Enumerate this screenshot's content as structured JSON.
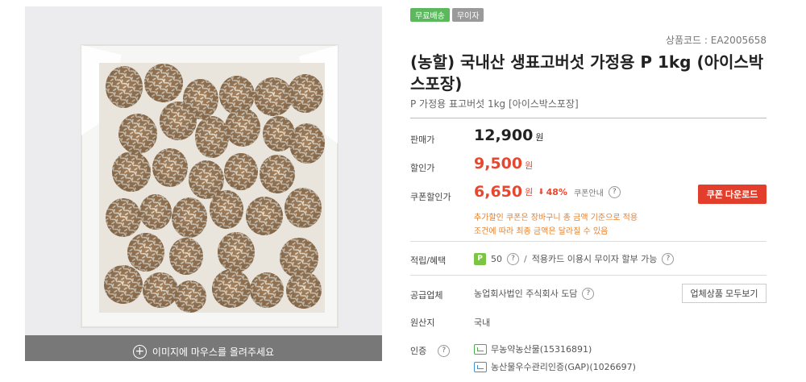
{
  "image": {
    "hover_hint": "이미지에 마우스를 올려주세요",
    "hover_icon": "plus-circle-icon",
    "colors": {
      "background": "#ececee",
      "box": "#f6f6f4",
      "mushroom": "#a98766",
      "overlay": "#6e6e6e"
    }
  },
  "badges": [
    {
      "label": "무료배송",
      "color": "#5cb85c"
    },
    {
      "label": "무이자",
      "color": "#9a9a9a"
    }
  ],
  "product": {
    "code": "상품코드 : EA2005658",
    "title": "(농할) 국내산 생표고버섯 가정용 P 1kg (아이스박스포장)",
    "subtitle": "P 가정용 표고버섯 1kg [아이스박스포장]"
  },
  "pricing": {
    "sale_label": "판매가",
    "sale_price": "12,900",
    "sale_unit": "원",
    "discount_label": "할인가",
    "discount_price": "9,500",
    "discount_unit": "원",
    "coupon_label": "쿠폰할인가",
    "coupon_price": "6,650",
    "coupon_unit": "원",
    "coupon_rate": "48%",
    "coupon_info": "쿠폰안내",
    "coupon_button": "쿠폰 다운로드",
    "note_line1": "추가할인 쿠폰은 장바구니 총 금액 기준으로 적용",
    "note_line2": "조건에 따라 최종 금액은 달라질 수 있음",
    "accent": "#e8472f",
    "note_color": "#e8802a"
  },
  "benefits": {
    "label": "적립/혜택",
    "points_icon": "P",
    "points": "50",
    "card_text": "적용카드 이용시 무이자 할부 가능"
  },
  "supplier": {
    "label": "공급업체",
    "name": "농업회사법인 주식회사 도담",
    "button": "업체상품 모두보기"
  },
  "origin": {
    "label": "원산지",
    "value": "국내"
  },
  "certification": {
    "label": "인증",
    "items": [
      {
        "text": "무농약농산물(15316891)",
        "icon": "organic-cert-icon"
      },
      {
        "text": "농산물우수관리인증(GAP)(1026697)",
        "icon": "gap-cert-icon"
      }
    ]
  },
  "help_glyph": "?",
  "slash": "/",
  "down_arrow": "⬇"
}
